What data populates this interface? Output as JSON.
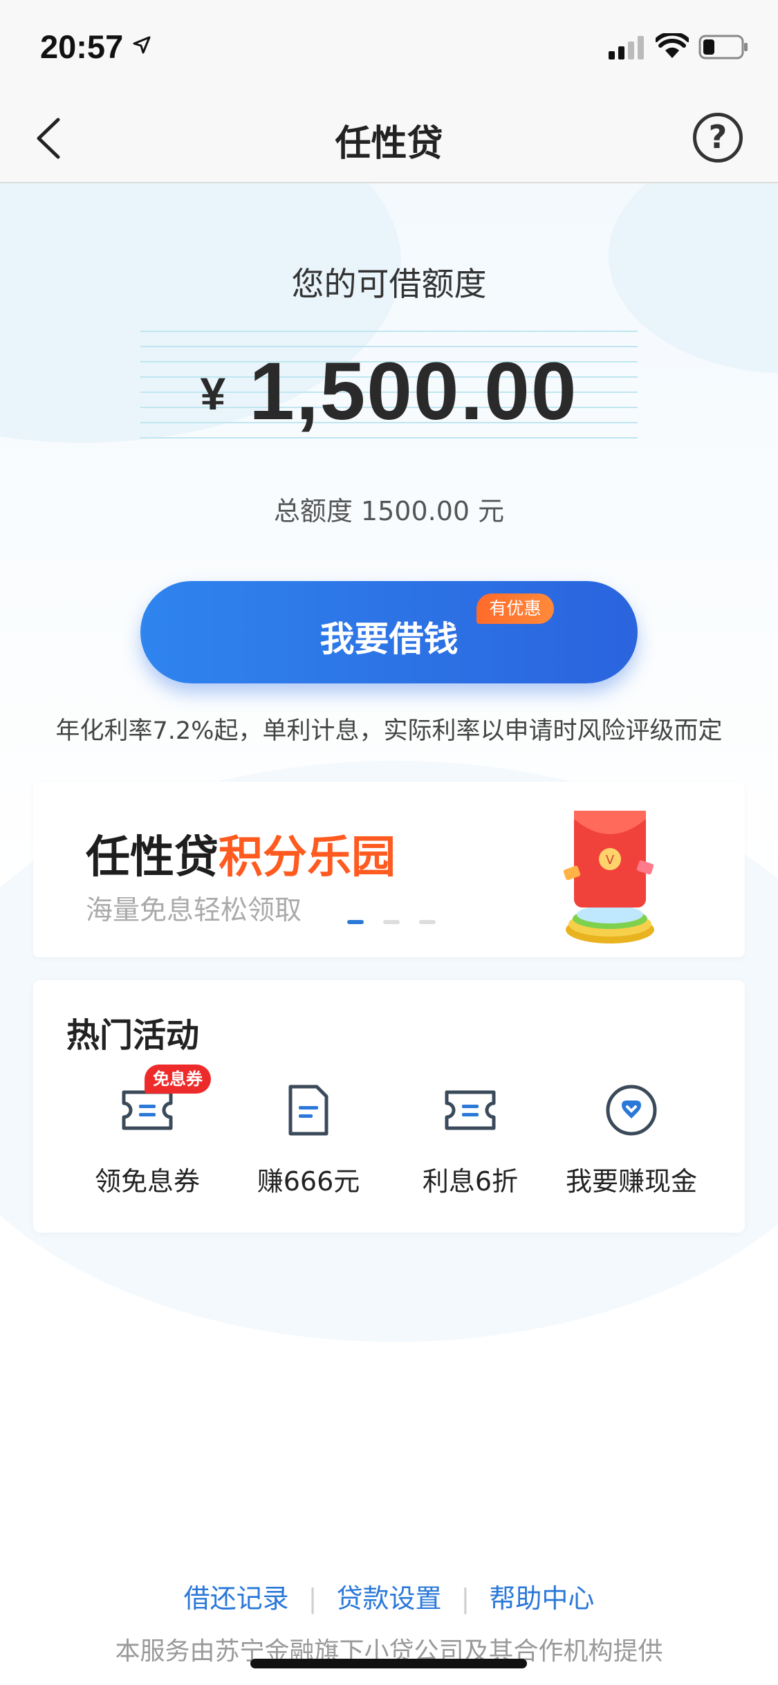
{
  "status_bar": {
    "time": "20:57"
  },
  "nav": {
    "title": "任性贷"
  },
  "credit": {
    "label": "您的可借额度",
    "currency": "¥",
    "amount": "1,500.00",
    "total_text": "总额度 1500.00 元"
  },
  "borrow": {
    "label": "我要借钱",
    "badge": "有优惠"
  },
  "rate_note": "年化利率7.2%起，单利计息，实际利率以申请时风险评级而定",
  "banner": {
    "title_black": "任性贷",
    "title_orange": "积分乐园",
    "subtitle": "海量免息轻松领取",
    "active_dot": 1,
    "dot_count": 3
  },
  "activities": {
    "title": "热门活动",
    "items": [
      {
        "label": "领免息券",
        "icon": "coupon-icon",
        "badge": "免息券"
      },
      {
        "label": "赚666元",
        "icon": "document-icon"
      },
      {
        "label": "利息6折",
        "icon": "coupon-icon"
      },
      {
        "label": "我要赚现金",
        "icon": "heart-badge-icon"
      }
    ]
  },
  "footer": {
    "links": [
      "借还记录",
      "贷款设置",
      "帮助中心"
    ],
    "note": "本服务由苏宁金融旗下小贷公司及其合作机构提供"
  },
  "colors": {
    "primary": "#2a78d8",
    "accent": "#ff5a1f",
    "badge_red": "#ee2b2b"
  }
}
